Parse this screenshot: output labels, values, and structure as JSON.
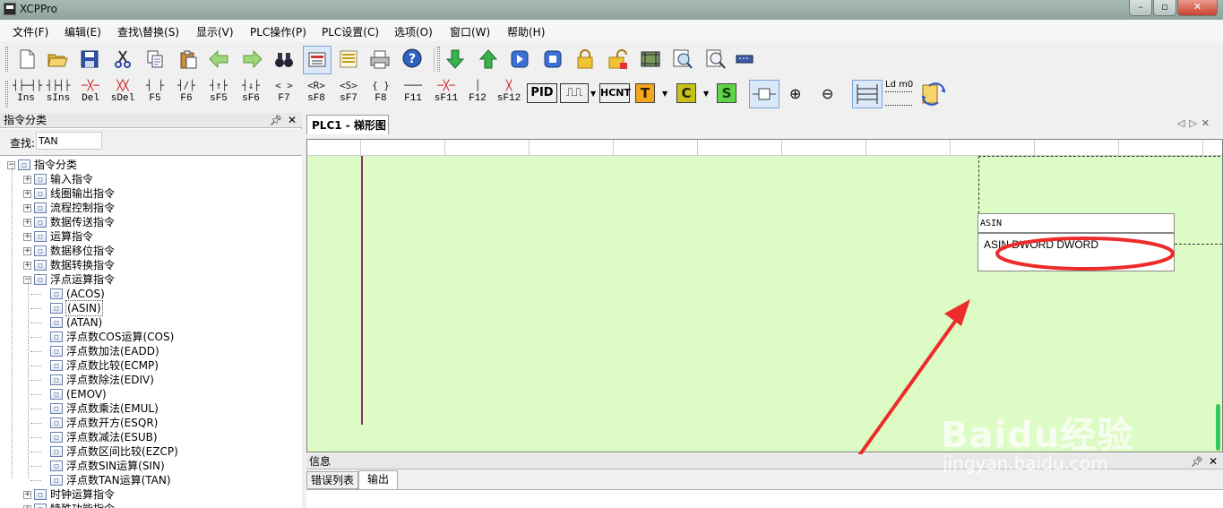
{
  "window": {
    "title": "XCPPro",
    "controls": [
      "–",
      "▫",
      "✕"
    ]
  },
  "menu": [
    "文件(F)",
    "编辑(E)",
    "查找\\替换(S)",
    "显示(V)",
    "PLC操作(P)",
    "PLC设置(C)",
    "选项(O)",
    "窗口(W)",
    "帮助(H)"
  ],
  "toolbar1": [
    {
      "name": "new-file-icon"
    },
    {
      "name": "open-folder-icon"
    },
    {
      "name": "save-icon"
    },
    {
      "name": "cut-icon"
    },
    {
      "name": "copy-icon"
    },
    {
      "name": "paste-icon"
    },
    {
      "name": "back-arrow-icon"
    },
    {
      "name": "forward-arrow-icon"
    },
    {
      "name": "binoculars-icon"
    },
    {
      "name": "monitor-icon"
    },
    {
      "name": "list-icon"
    },
    {
      "name": "print-icon"
    },
    {
      "name": "help-icon"
    },
    {
      "name": "download-arrow-icon"
    },
    {
      "name": "upload-arrow-icon"
    },
    {
      "name": "run-icon"
    },
    {
      "name": "stop-icon"
    },
    {
      "name": "lock-icon"
    },
    {
      "name": "unlock-icon"
    },
    {
      "name": "film-icon"
    },
    {
      "name": "zoom-preview-icon"
    },
    {
      "name": "search-doc-icon"
    },
    {
      "name": "port-icon"
    }
  ],
  "toolbar2": [
    {
      "sym": "┤├─┤├",
      "label": "Ins"
    },
    {
      "sym": "┤├┤├",
      "label": "sIns"
    },
    {
      "sym": "─╳─",
      "label": "Del"
    },
    {
      "sym": "╳╳",
      "label": "sDel"
    },
    {
      "sym": "┤ ├",
      "label": "F5"
    },
    {
      "sym": "┤/├",
      "label": "F6"
    },
    {
      "sym": "┤↑├",
      "label": "sF5"
    },
    {
      "sym": "┤↓├",
      "label": "sF6"
    },
    {
      "sym": "< >",
      "label": "F7"
    },
    {
      "sym": "<R>",
      "label": "sF8"
    },
    {
      "sym": "<S>",
      "label": "sF7"
    },
    {
      "sym": "{ }",
      "label": "F8"
    },
    {
      "sym": "───",
      "label": "F11"
    },
    {
      "sym": "─╳─",
      "label": "sF11"
    },
    {
      "sym": "│",
      "label": "F12"
    },
    {
      "sym": "╳",
      "label": "sF12"
    }
  ],
  "toolbar2_blocks": {
    "pid": "PID",
    "pulse": "⎍⎍",
    "hcnt": "HCNT",
    "t": "T",
    "c": "C",
    "s": "S",
    "zoom_in": "⊕",
    "zoom_out": "⊖",
    "ldm0": "Ld m0"
  },
  "left_pane": {
    "title": "指令分类",
    "find_label": "查找:",
    "find_value": "TAN",
    "tree": [
      {
        "level": 0,
        "label": "指令分类",
        "exp": "−"
      },
      {
        "level": 1,
        "label": "输入指令",
        "exp": "+"
      },
      {
        "level": 1,
        "label": "线圈输出指令",
        "exp": "+"
      },
      {
        "level": 1,
        "label": "流程控制指令",
        "exp": "+"
      },
      {
        "level": 1,
        "label": "数据传送指令",
        "exp": "+"
      },
      {
        "level": 1,
        "label": "运算指令",
        "exp": "+"
      },
      {
        "level": 1,
        "label": "数据移位指令",
        "exp": "+"
      },
      {
        "level": 1,
        "label": "数据转换指令",
        "exp": "+"
      },
      {
        "level": 1,
        "label": "浮点运算指令",
        "exp": "−"
      },
      {
        "level": 2,
        "label": "(ACOS)"
      },
      {
        "level": 2,
        "label": "(ASIN)",
        "selected": true
      },
      {
        "level": 2,
        "label": "(ATAN)"
      },
      {
        "level": 2,
        "label": "浮点数COS运算(COS)"
      },
      {
        "level": 2,
        "label": "浮点数加法(EADD)"
      },
      {
        "level": 2,
        "label": "浮点数比较(ECMP)"
      },
      {
        "level": 2,
        "label": "浮点数除法(EDIV)"
      },
      {
        "level": 2,
        "label": "(EMOV)"
      },
      {
        "level": 2,
        "label": "浮点数乘法(EMUL)"
      },
      {
        "level": 2,
        "label": "浮点数开方(ESQR)"
      },
      {
        "level": 2,
        "label": "浮点数减法(ESUB)"
      },
      {
        "level": 2,
        "label": "浮点数区间比较(EZCP)"
      },
      {
        "level": 2,
        "label": "浮点数SIN运算(SIN)"
      },
      {
        "level": 2,
        "label": "浮点数TAN运算(TAN)"
      },
      {
        "level": 1,
        "label": "时钟运算指令",
        "exp": "+"
      },
      {
        "level": 1,
        "label": "特殊功能指令",
        "exp": "+"
      }
    ]
  },
  "editor": {
    "tab_label": "PLC1 - 梯形图",
    "input_value": "ASIN",
    "hint": "ASIN DWORD DWORD",
    "nav": [
      "◁",
      "▷",
      "✕"
    ]
  },
  "info_pane": {
    "title": "信息",
    "tabs": [
      "错误列表",
      "输出"
    ]
  },
  "watermark": {
    "logo": "Baidu经验",
    "url": "jingyan.baidu.com"
  },
  "colors": {
    "ladder_bg": "#ddfcc5",
    "annotation": "#ee2b2b"
  }
}
